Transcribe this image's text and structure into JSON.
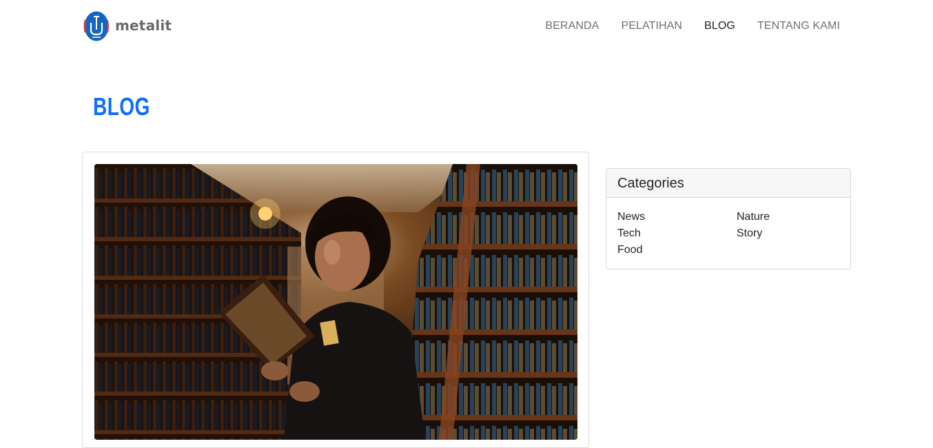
{
  "brand": {
    "name": "metalit",
    "logo_icon": "metalit-logo-icon"
  },
  "nav": {
    "items": [
      {
        "label": "BERANDA",
        "active": false
      },
      {
        "label": "PELATIHAN",
        "active": false
      },
      {
        "label": "BLOG",
        "active": true
      },
      {
        "label": "TENTANG KAMI",
        "active": false
      }
    ]
  },
  "page": {
    "title": "BLOG"
  },
  "post": {
    "image": "photo-man-holding-book-in-bookstore"
  },
  "categories": {
    "title": "Categories",
    "items": [
      "News",
      "Nature",
      "Tech",
      "Story",
      "Food"
    ]
  },
  "colors": {
    "accent": "#0d6efd",
    "nav_text": "#707070",
    "nav_active": "#1e1e1e",
    "logo_blue": "#1565c0",
    "logo_red": "#d83a3a"
  }
}
